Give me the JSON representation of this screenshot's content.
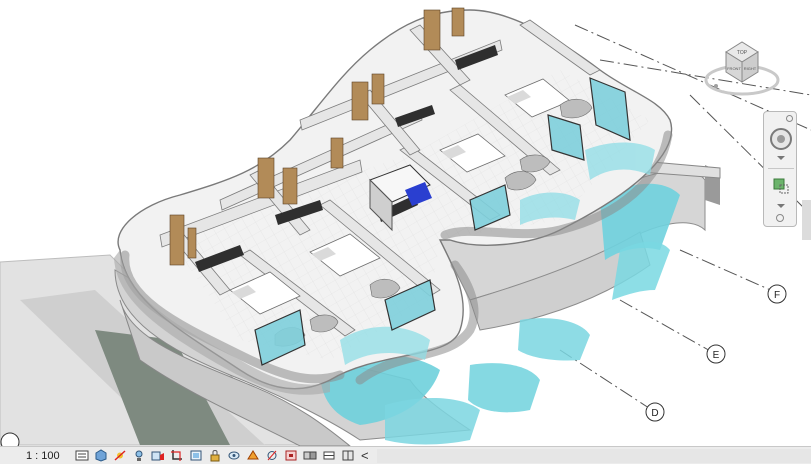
{
  "view": {
    "scale": "1 : 100"
  },
  "viewcube": {
    "top_label": "TOP",
    "front_label": "FRONT",
    "right_label": "RIGHT"
  },
  "grid_markers": [
    "F",
    "E",
    "D"
  ],
  "view_control_bar": {
    "icons": [
      "detail-level-icon",
      "visual-style-icon",
      "sun-path-icon",
      "shadows-icon",
      "rendering-icon",
      "crop-view-icon",
      "show-crop-region-icon",
      "lock-3d-view-icon",
      "temporary-hide-isolate-icon",
      "reveal-hidden-elements-icon",
      "analytical-model-icon",
      "highlight-displacement-icon",
      "reveal-constraints-icon",
      "worksharing-display-icon",
      "design-options-icon"
    ],
    "scroll_left": "<"
  },
  "colors": {
    "wall": "#e9e9e9",
    "wall_shadow": "#9c9c9c",
    "floor": "#f4f4f4",
    "wood": "#b08a58",
    "glass": "#7fd8e0",
    "pool": "#73d3df",
    "ground": "#d8d8d8",
    "dark": "#3a3a3a"
  }
}
